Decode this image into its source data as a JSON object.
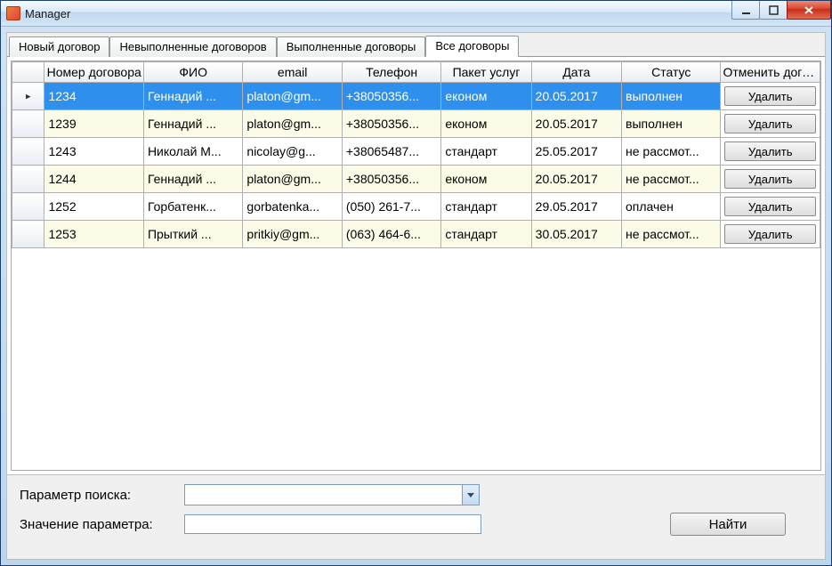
{
  "window": {
    "title": "Manager"
  },
  "tabs": [
    {
      "label": "Новый договор",
      "active": false
    },
    {
      "label": "Невыполненные договоров",
      "active": false
    },
    {
      "label": "Выполненные договоры",
      "active": false
    },
    {
      "label": "Все договоры",
      "active": true
    }
  ],
  "grid": {
    "headers": {
      "number": "Номер договора",
      "fio": "ФИО",
      "email": "email",
      "phone": "Телефон",
      "package": "Пакет услуг",
      "date": "Дата",
      "status": "Статус",
      "cancel": "Отменить договор"
    },
    "delete_label": "Удалить",
    "rows": [
      {
        "number": "1234",
        "fio": "Геннадий ...",
        "email": "platon@gm...",
        "phone": "+38050356...",
        "package": "економ",
        "date": "20.05.2017",
        "status": "выполнен",
        "selected": true,
        "alt": false
      },
      {
        "number": "1239",
        "fio": " Геннадий ...",
        "email": "platon@gm...",
        "phone": "+38050356...",
        "package": "економ",
        "date": "20.05.2017",
        "status": "выполнен",
        "selected": false,
        "alt": true
      },
      {
        "number": "1243",
        "fio": "Николай М...",
        "email": "nicolay@g...",
        "phone": "+38065487...",
        "package": "стандарт",
        "date": "25.05.2017",
        "status": "не рассмот...",
        "selected": false,
        "alt": false
      },
      {
        "number": "1244",
        "fio": "Геннадий ...",
        "email": "platon@gm...",
        "phone": "+38050356...",
        "package": "економ",
        "date": "20.05.2017",
        "status": "не рассмот...",
        "selected": false,
        "alt": true
      },
      {
        "number": "1252",
        "fio": "Горбатенк...",
        "email": "gorbatenka...",
        "phone": "(050) 261-7...",
        "package": "стандарт",
        "date": "29.05.2017",
        "status": "оплачен",
        "selected": false,
        "alt": false
      },
      {
        "number": "1253",
        "fio": "Прыткий ...",
        "email": "pritkiy@gm...",
        "phone": "(063) 464-6...",
        "package": "стандарт",
        "date": "30.05.2017",
        "status": "не рассмот...",
        "selected": false,
        "alt": true
      }
    ]
  },
  "search": {
    "param_label": "Параметр поиска:",
    "value_label": "Значение параметра:",
    "combo_value": "",
    "text_value": "",
    "find_label": "Найти"
  }
}
